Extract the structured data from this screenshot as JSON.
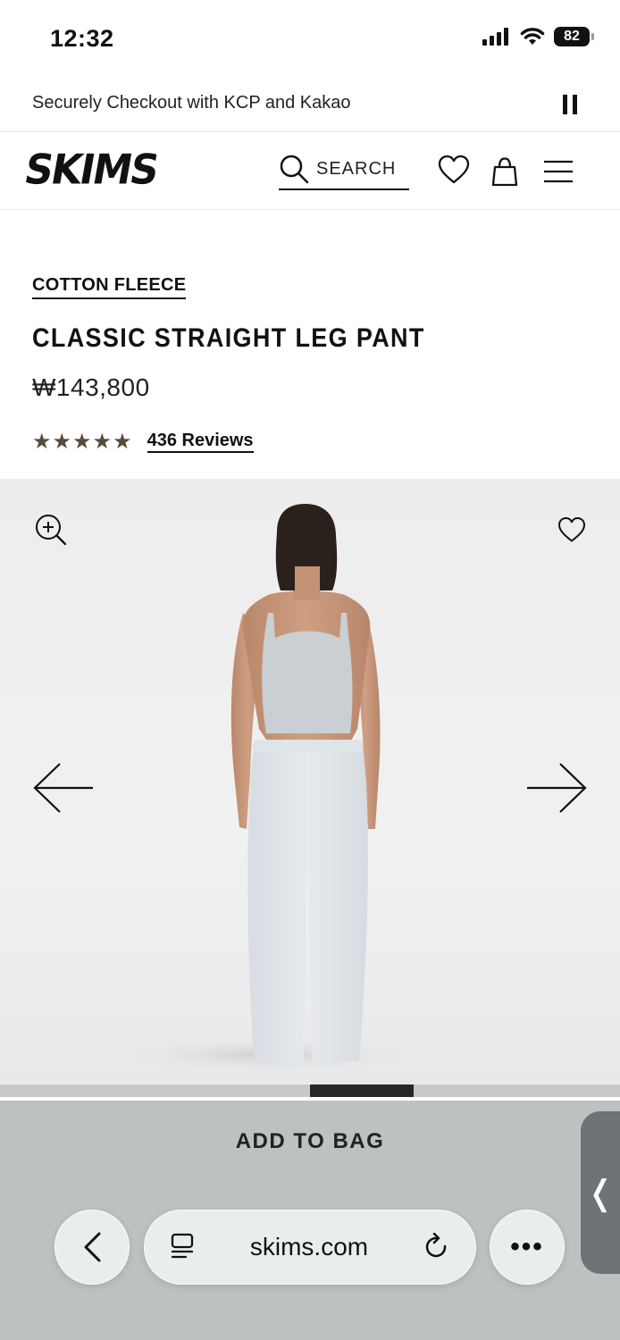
{
  "status": {
    "time": "12:32",
    "battery": "82"
  },
  "announcement": {
    "text": "Securely Checkout with KCP and Kakao"
  },
  "header": {
    "logo": "SKIMS",
    "search_label": "SEARCH"
  },
  "product": {
    "collection": "COTTON FLEECE",
    "title": "CLASSIC STRAIGHT LEG PANT",
    "price": "₩143,800",
    "rating": 5,
    "stars": "★★★★★",
    "reviews_label": "436 Reviews",
    "star_color": "#5a4a3a"
  },
  "gallery": {
    "progress_fraction": 0.167
  },
  "cta": {
    "add_to_bag": "ADD TO BAG"
  },
  "browser": {
    "url": "skims.com",
    "more": "•••",
    "side_tab": "❬"
  }
}
